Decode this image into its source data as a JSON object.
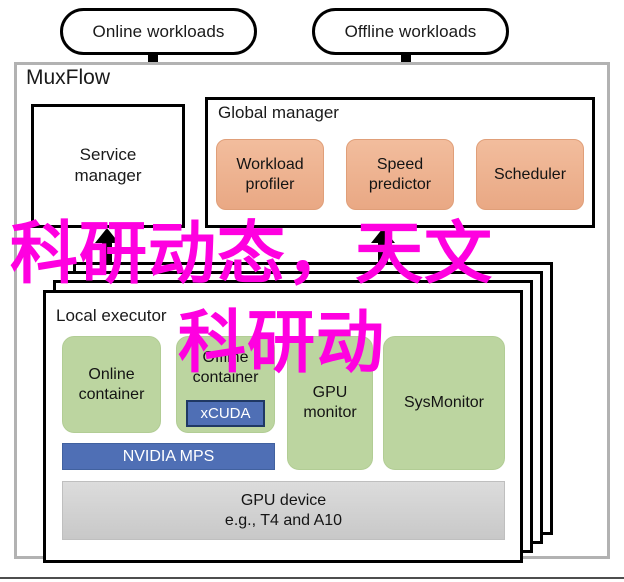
{
  "diagram": {
    "title": "MuxFlow",
    "workloads": [
      {
        "label": "Online workloads"
      },
      {
        "label": "Offline workloads"
      }
    ],
    "service_manager": {
      "label_line1": "Service",
      "label_line2": "manager"
    },
    "global_manager": {
      "title": "Global manager",
      "modules": [
        {
          "line1": "Workload",
          "line2": "profiler"
        },
        {
          "line1": "Speed",
          "line2": "predictor"
        },
        {
          "line1": "Scheduler",
          "line2": ""
        }
      ]
    },
    "local_executor": {
      "title": "Local executor",
      "containers": [
        {
          "line1": "Online",
          "line2": "container"
        },
        {
          "line1": "Offline",
          "line2": "container"
        },
        {
          "line1": "GPU",
          "line2": "monitor"
        },
        {
          "line1": "SysMonitor",
          "line2": ""
        }
      ],
      "xcuda_label": "xCUDA",
      "mps_label": "NVIDIA MPS",
      "gpu_device": {
        "line1": "GPU device",
        "line2": "e.g., T4 and A10"
      },
      "stack_count": 3
    },
    "arrows": {
      "online_down": "arrow-down",
      "offline_down": "arrow-down",
      "service_up": "arrow-up",
      "executor_up": "arrow-up"
    }
  },
  "watermark": {
    "line1": "科研动态，天文",
    "line2": "科研动"
  },
  "colors": {
    "orange": "#e9a884",
    "green": "#bcd5a0",
    "blue": "#4f6fb5",
    "gray": "#c8c8c8",
    "frame_gray": "#b2b2b2",
    "black": "#000000",
    "watermark_magenta": "#ff00e0"
  }
}
